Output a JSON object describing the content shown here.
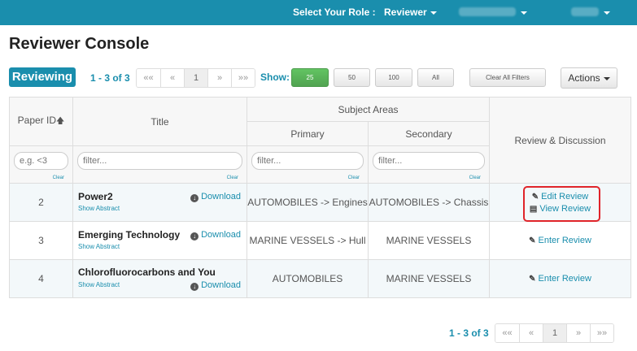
{
  "topbar": {
    "role_label": "Select Your Role :",
    "role_value": "Reviewer"
  },
  "page_title": "Reviewer Console",
  "toolbar": {
    "reviewing_label": "Reviewing",
    "count_text": "1 - 3 of 3",
    "pager": [
      "««",
      "«",
      "1",
      "»",
      "»»"
    ],
    "show_label": "Show:",
    "show_options": [
      "25",
      "50",
      "100",
      "All"
    ],
    "clear_filters": "Clear All Filters",
    "actions_label": "Actions"
  },
  "table": {
    "headers": {
      "paper_id": "Paper ID",
      "title": "Title",
      "subject_areas": "Subject Areas",
      "primary": "Primary",
      "secondary": "Secondary",
      "review": "Review & Discussion"
    },
    "filters": {
      "paper_id_placeholder": "e.g. <3",
      "filter_placeholder": "filter...",
      "clear": "Clear"
    },
    "rows": [
      {
        "id": "2",
        "title": "Power2",
        "show_abstract": "Show Abstract",
        "download": "Download",
        "primary": "AUTOMOBILES -> Engines",
        "secondary": "AUTOMOBILES -> Chassis",
        "links": [
          "Edit Review",
          "View Review"
        ]
      },
      {
        "id": "3",
        "title": "Emerging Technology",
        "show_abstract": "Show Abstract",
        "download": "Download",
        "primary": "MARINE VESSELS -> Hull",
        "secondary": "MARINE VESSELS",
        "links": [
          "Enter Review"
        ]
      },
      {
        "id": "4",
        "title": "Chlorofluorocarbons and You",
        "show_abstract": "Show Abstract",
        "download": "Download",
        "primary": "AUTOMOBILES",
        "secondary": "MARINE VESSELS",
        "links": [
          "Enter Review"
        ]
      }
    ]
  },
  "footer": {
    "count_text": "1 - 3 of 3",
    "pager": [
      "««",
      "«",
      "1",
      "»",
      "»»"
    ]
  },
  "colors": {
    "brand": "#1a8ead",
    "highlight": "#e0242a",
    "show_selected": "#5cb85c"
  }
}
